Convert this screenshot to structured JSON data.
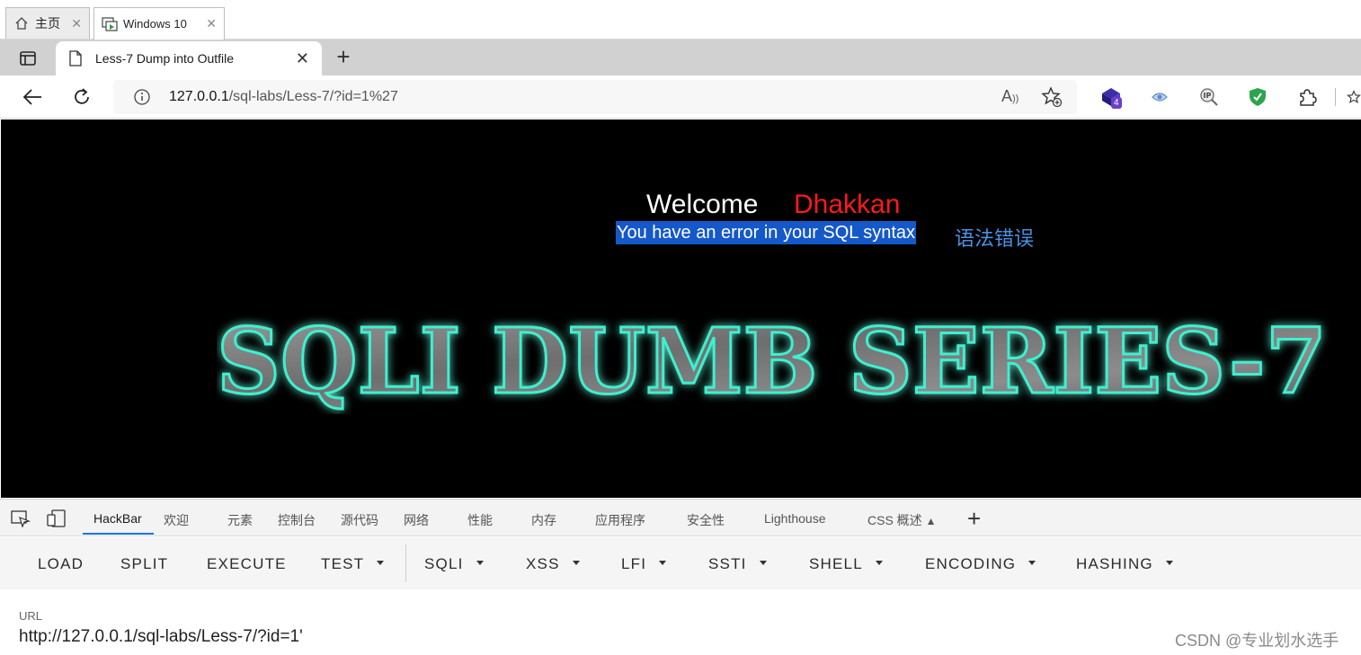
{
  "vm_tabs": [
    {
      "label": "主页",
      "icon": "home-icon"
    },
    {
      "label": "Windows 10",
      "icon": "vm-icon"
    }
  ],
  "browser": {
    "tab_title": "Less-7 Dump into Outfile",
    "address": {
      "host": "127.0.0.1",
      "path": "/sql-labs/Less-7/?id=1%27"
    },
    "extension_badge": "4"
  },
  "page": {
    "welcome": "Welcome",
    "name": "Dhakkan",
    "error_message": "You have an error in your SQL syntax",
    "error_annotation": "语法错误",
    "banner_text": "SQLI DUMB SERIES-7"
  },
  "devtools": {
    "tabs": [
      "HackBar",
      "欢迎",
      "元素",
      "控制台",
      "源代码",
      "网络",
      "性能",
      "内存",
      "应用程序",
      "安全性",
      "Lighthouse",
      "CSS 概述"
    ],
    "hackbar_buttons": [
      "LOAD",
      "SPLIT",
      "EXECUTE",
      "TEST",
      "SQLI",
      "XSS",
      "LFI",
      "SSTI",
      "SHELL",
      "ENCODING",
      "HASHING"
    ],
    "url_label": "URL",
    "url_value": "http://127.0.0.1/sql-labs/Less-7/?id=1'"
  },
  "watermark": "CSDN @专业划水选手",
  "colors": {
    "page_bg": "#000000",
    "name_red": "#ff1a1a",
    "error_highlight": "#1558c9",
    "annotation_blue": "#4a90e2",
    "accent": "#1a73e8"
  }
}
